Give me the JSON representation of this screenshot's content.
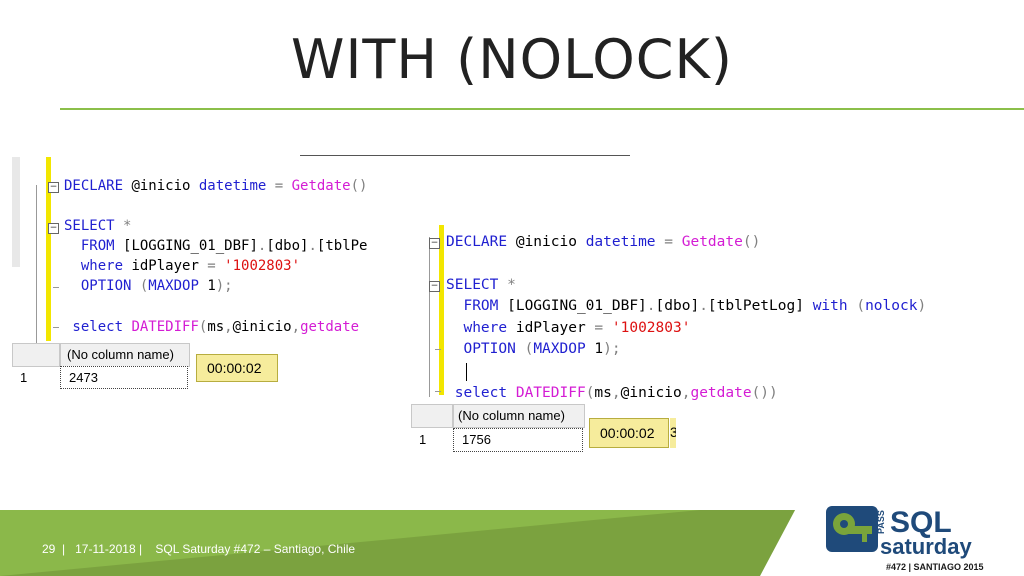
{
  "slide": {
    "title": "WITH (NOLOCK)"
  },
  "left_editor": {
    "lines": [
      {
        "id": "l1",
        "parts": [
          [
            "kw",
            "DECLARE "
          ],
          [
            "",
            "@inicio "
          ],
          [
            "kw",
            "datetime "
          ],
          [
            "gr",
            "= "
          ],
          [
            "fn",
            "Getdate"
          ],
          [
            "gr",
            "()"
          ]
        ]
      },
      {
        "id": "l2",
        "parts": [
          [
            "kw",
            "SELECT "
          ],
          [
            "gr",
            "*"
          ]
        ]
      },
      {
        "id": "l3",
        "parts": [
          [
            "kw",
            "  FROM "
          ],
          [
            "",
            "[LOGGING_01_DBF]"
          ],
          [
            "gr",
            "."
          ],
          [
            "",
            "[dbo]"
          ],
          [
            "gr",
            "."
          ],
          [
            "",
            "[tblPe"
          ]
        ]
      },
      {
        "id": "l4",
        "parts": [
          [
            "kw",
            "  where "
          ],
          [
            "",
            "idPlayer "
          ],
          [
            "gr",
            "= "
          ],
          [
            "str",
            "'1002803'"
          ]
        ]
      },
      {
        "id": "l5",
        "parts": [
          [
            "kw",
            "  OPTION "
          ],
          [
            "gr",
            "("
          ],
          [
            "kw",
            "MAXDOP "
          ],
          [
            "",
            "1"
          ],
          [
            "gr",
            ");"
          ]
        ]
      },
      {
        "id": "l6",
        "parts": [
          [
            "kw",
            " select "
          ],
          [
            "fn",
            "DATEDIFF"
          ],
          [
            "gr",
            "("
          ],
          [
            "",
            "ms"
          ],
          [
            "gr",
            ","
          ],
          [
            "",
            "@inicio"
          ],
          [
            "gr",
            ","
          ],
          [
            "fn",
            "getdate"
          ]
        ]
      }
    ],
    "result": {
      "column_header": "(No column name)",
      "row_number": "1",
      "value": "2473",
      "elapsed": "00:00:02"
    }
  },
  "right_editor": {
    "lines": [
      {
        "id": "r1",
        "parts": [
          [
            "kw",
            "DECLARE "
          ],
          [
            "",
            "@inicio "
          ],
          [
            "kw",
            "datetime "
          ],
          [
            "gr",
            "= "
          ],
          [
            "fn",
            "Getdate"
          ],
          [
            "gr",
            "()"
          ]
        ]
      },
      {
        "id": "r2",
        "parts": [
          [
            "kw",
            "SELECT "
          ],
          [
            "gr",
            "*"
          ]
        ]
      },
      {
        "id": "r3",
        "parts": [
          [
            "kw",
            "  FROM "
          ],
          [
            "",
            "[LOGGING_01_DBF]"
          ],
          [
            "gr",
            "."
          ],
          [
            "",
            "[dbo]"
          ],
          [
            "gr",
            "."
          ],
          [
            "",
            "[tblPetLog] "
          ],
          [
            "kw",
            "with "
          ],
          [
            "gr",
            "("
          ],
          [
            "kw",
            "nolock"
          ],
          [
            "gr",
            ")"
          ]
        ]
      },
      {
        "id": "r4",
        "parts": [
          [
            "kw",
            "  where "
          ],
          [
            "",
            "idPlayer "
          ],
          [
            "gr",
            "= "
          ],
          [
            "str",
            "'1002803'"
          ]
        ]
      },
      {
        "id": "r5",
        "parts": [
          [
            "kw",
            "  OPTION "
          ],
          [
            "gr",
            "("
          ],
          [
            "kw",
            "MAXDOP "
          ],
          [
            "",
            "1"
          ],
          [
            "gr",
            ");"
          ]
        ]
      },
      {
        "id": "r6",
        "parts": [
          [
            "kw",
            " select "
          ],
          [
            "fn",
            "DATEDIFF"
          ],
          [
            "gr",
            "("
          ],
          [
            "",
            "ms"
          ],
          [
            "gr",
            ","
          ],
          [
            "",
            "@inicio"
          ],
          [
            "gr",
            ","
          ],
          [
            "fn",
            "getdate"
          ],
          [
            "gr",
            "())"
          ]
        ]
      }
    ],
    "result": {
      "column_header": "(No column name)",
      "row_number": "1",
      "value": "1756",
      "elapsed": "00:00:02",
      "elapsed_overflow": "3"
    }
  },
  "footer": {
    "text": "29  |   17-11-2018 |    SQL Saturday #472 – Santiago, Chile"
  },
  "logo": {
    "pass": "PASS",
    "sql": "SQL",
    "saturday": "saturday",
    "event": "#472 | SANTIAGO 2015",
    "colors": {
      "blue": "#1f4a7a",
      "green": "#7aa43b",
      "dark": "#1a1a1a"
    }
  }
}
